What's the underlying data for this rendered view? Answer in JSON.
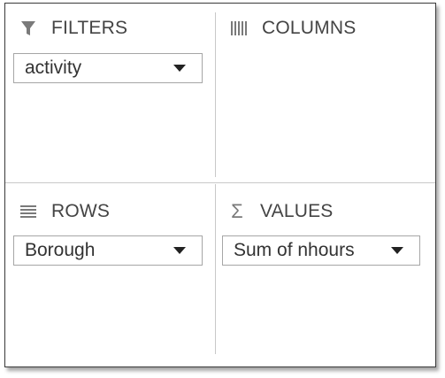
{
  "pivot_areas": {
    "filters": {
      "title": "FILTERS",
      "icon": "filter-icon",
      "fields": [
        "activity"
      ]
    },
    "columns": {
      "title": "COLUMNS",
      "icon": "columns-icon",
      "fields": []
    },
    "rows": {
      "title": "ROWS",
      "icon": "rows-icon",
      "fields": [
        "Borough"
      ]
    },
    "values": {
      "title": "VALUES",
      "icon": "sigma-icon",
      "fields": [
        "Sum of nhours"
      ]
    }
  },
  "colors": {
    "border": "#a6a6a6",
    "divider": "#c8c8c8",
    "text": "#333333",
    "icon": "#777777"
  }
}
